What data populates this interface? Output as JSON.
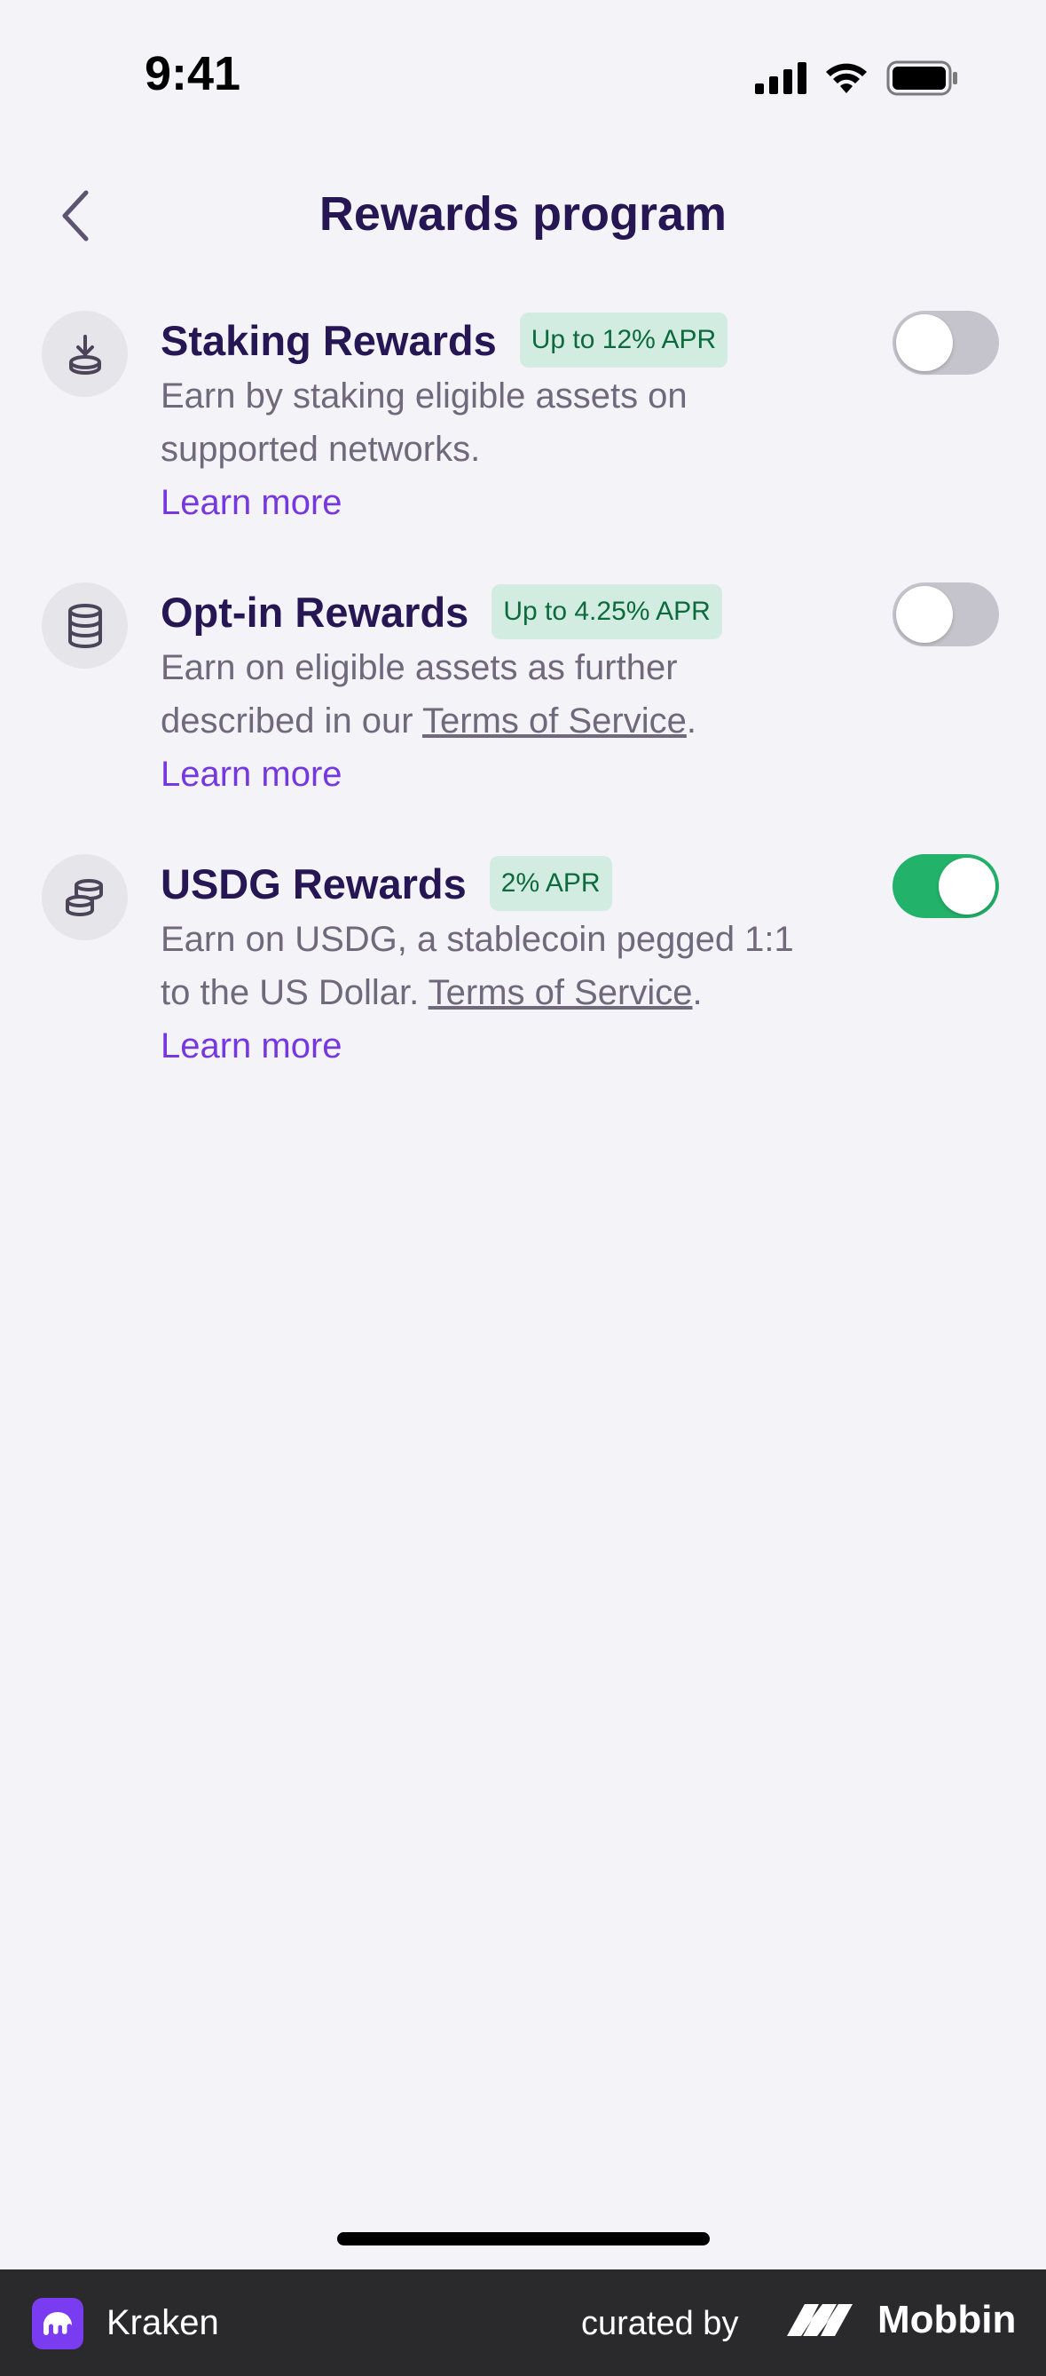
{
  "status_bar": {
    "time": "9:41"
  },
  "nav": {
    "title": "Rewards program"
  },
  "rewards": [
    {
      "title": "Staking Rewards",
      "badge": "Up to 12% APR",
      "desc_line1": "Earn by staking eligible assets on",
      "desc_line2": "supported networks.",
      "learn_more": "Learn more",
      "enabled": false
    },
    {
      "title": "Opt-in Rewards",
      "badge": "Up to 4.25% APR",
      "desc_line1": "Earn on eligible assets as further",
      "desc_line2_prefix": "described in our ",
      "desc_line2_link": "Terms of Service",
      "desc_line2_suffix": ".",
      "learn_more": "Learn more",
      "enabled": false
    },
    {
      "title": "USDG Rewards",
      "badge": "2% APR",
      "desc_line1": "Earn on USDG, a stablecoin pegged 1:1",
      "desc_line2_prefix": "to the US Dollar. ",
      "desc_line2_link": "Terms of Service",
      "desc_line2_suffix": ".",
      "learn_more": "Learn more",
      "enabled": true
    }
  ],
  "footer": {
    "app_name": "Kraken",
    "curated_by": "curated by",
    "brand": "Mobbin"
  },
  "colors": {
    "background": "#f4f3f8",
    "title": "#261653",
    "accent_link": "#7538e0",
    "badge_bg": "#d3ece1",
    "badge_text": "#0c6a3d",
    "toggle_on": "#23b26a",
    "toggle_off": "#c5c3cb"
  }
}
